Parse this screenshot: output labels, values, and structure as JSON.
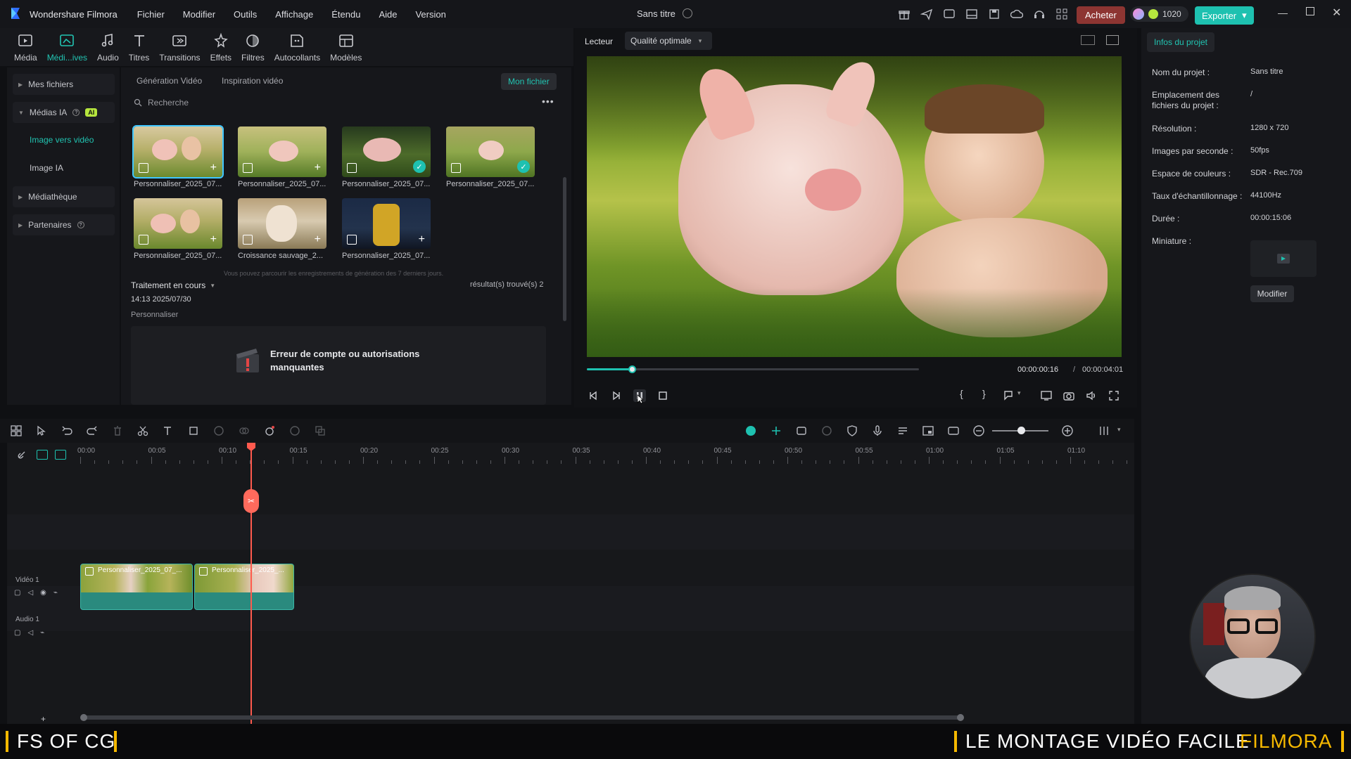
{
  "app": {
    "name": "Wondershare Filmora",
    "project_title": "Sans titre",
    "credits": "1020",
    "buy_label": "Acheter",
    "export_label": "Exporter"
  },
  "menu": [
    "Fichier",
    "Modifier",
    "Outils",
    "Affichage",
    "Étendu",
    "Aide",
    "Version"
  ],
  "toolbar": [
    {
      "label": "Média",
      "icon": "media-icon"
    },
    {
      "label": "Médi...ives",
      "icon": "ai-media-icon"
    },
    {
      "label": "Audio",
      "icon": "audio-icon"
    },
    {
      "label": "Titres",
      "icon": "titles-icon"
    },
    {
      "label": "Transitions",
      "icon": "transitions-icon"
    },
    {
      "label": "Effets",
      "icon": "effects-icon"
    },
    {
      "label": "Filtres",
      "icon": "filters-icon"
    },
    {
      "label": "Autocollants",
      "icon": "stickers-icon"
    },
    {
      "label": "Modèles",
      "icon": "templates-icon"
    }
  ],
  "sidebar": {
    "my_files": "Mes fichiers",
    "ai_media": "Médias IA",
    "ai_badge": "AI",
    "image_to_video": "Image vers vidéo",
    "ai_image": "Image IA",
    "library": "Médiathèque",
    "partners": "Partenaires"
  },
  "media": {
    "tabs": [
      "Génération Vidéo",
      "Inspiration vidéo"
    ],
    "my_file_button": "Mon fichier",
    "search_placeholder": "Recherche",
    "items": [
      {
        "caption": "Personnaliser_2025_07...",
        "status": "plus"
      },
      {
        "caption": "Personnaliser_2025_07...",
        "status": "plus"
      },
      {
        "caption": "Personnaliser_2025_07...",
        "status": "check"
      },
      {
        "caption": "Personnaliser_2025_07...",
        "status": "check"
      },
      {
        "caption": "Personnaliser_2025_07...",
        "status": "plus"
      },
      {
        "caption": "Croissance sauvage_2...",
        "status": "plus"
      },
      {
        "caption": "Personnaliser_2025_07...",
        "status": "plus"
      }
    ],
    "history_note": "Vous pouvez parcourir les enregistrements de génération des 7 derniers jours.",
    "processing_label": "Traitement en cours",
    "results_label": "résultat(s) trouvé(s) 2",
    "processing_time": "14:13 2025/07/30",
    "processing_type": "Personnaliser",
    "error_message": "Erreur de compte ou autorisations manquantes"
  },
  "player": {
    "tab": "Lecteur",
    "quality": "Qualité optimale",
    "current_time": "00:00:00:16",
    "total_time": "00:00:04:01",
    "progress": 0.135
  },
  "project_info": {
    "tab": "Infos du projet",
    "rows": [
      {
        "label": "Nom du projet :",
        "value": "Sans titre"
      },
      {
        "label": "Emplacement des fichiers du projet :",
        "value": "/"
      },
      {
        "label": "Résolution :",
        "value": "1280 x 720"
      },
      {
        "label": "Images par seconde :",
        "value": "50fps"
      },
      {
        "label": "Espace de couleurs :",
        "value": "SDR - Rec.709"
      },
      {
        "label": "Taux d'échantillonnage :",
        "value": "44100Hz"
      },
      {
        "label": "Durée :",
        "value": "00:00:15:06"
      }
    ],
    "thumbnail_label": "Miniature :",
    "modify_button": "Modifier"
  },
  "timeline": {
    "ruler": [
      "00:00",
      "00:05",
      "00:10",
      "00:15",
      "00:20",
      "00:25",
      "00:30",
      "00:35",
      "00:40",
      "00:45",
      "00:50",
      "00:55",
      "01:00",
      "01:05",
      "01:10"
    ],
    "video_track": "Vidéo 1",
    "audio_track": "Audio 1",
    "clips": [
      {
        "name": "Personnaliser_2025_07_..."
      },
      {
        "name": "Personnaliser_2025_..."
      }
    ]
  },
  "banner": {
    "left": "FS OF CG",
    "right_white": "LE MONTAGE VIDÉO FACILE",
    "right_accent": "FILMORA",
    "accent_color": "#f5b800"
  }
}
